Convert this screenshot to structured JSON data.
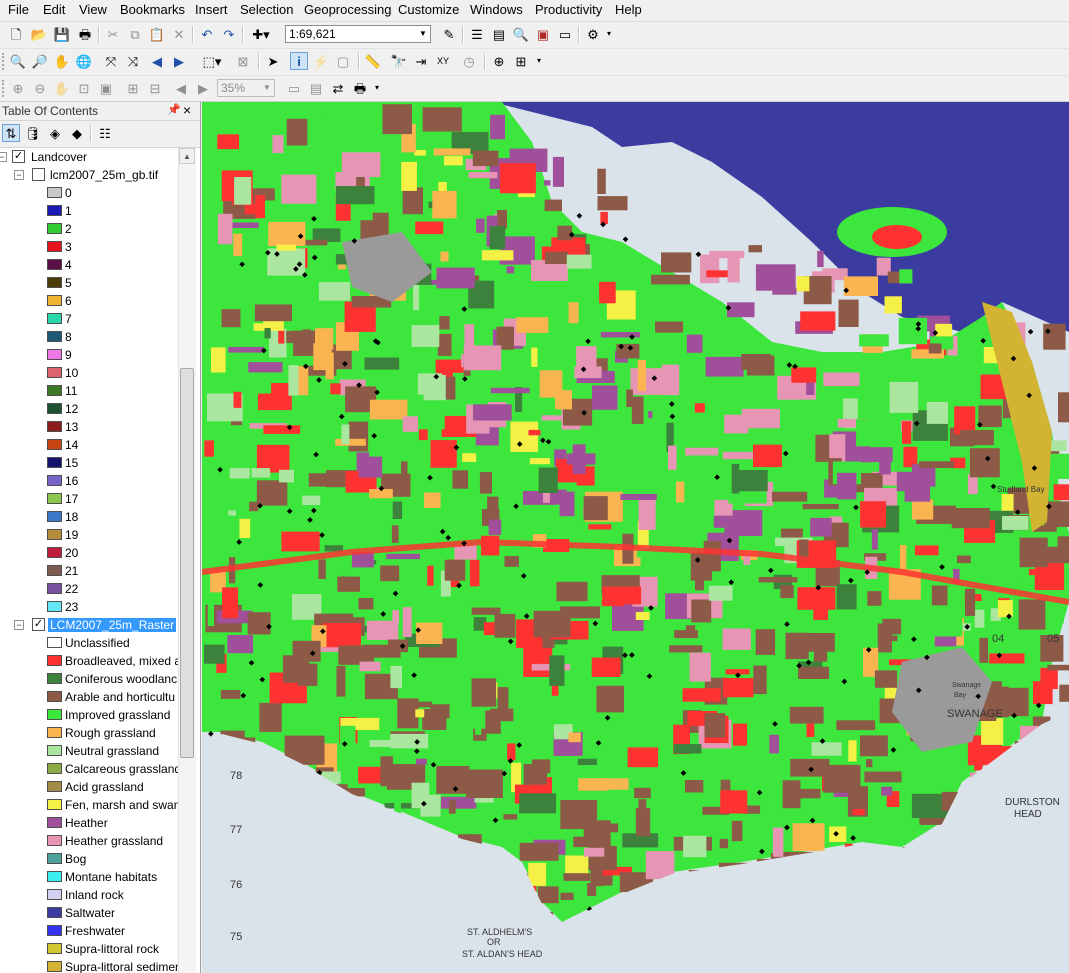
{
  "menu": [
    "File",
    "Edit",
    "View",
    "Bookmarks",
    "Insert",
    "Selection",
    "Geoprocessing",
    "Customize",
    "Windows",
    "Productivity",
    "Help"
  ],
  "toolbar": {
    "scale_value": "1:69,621",
    "zoom_percent": "35%"
  },
  "toc": {
    "title": "Table Of Contents",
    "pin_icon": "pin-icon",
    "close_icon": "close-icon",
    "group": {
      "name": "Landcover",
      "checked": true,
      "expanded": true
    },
    "layer1": {
      "name": "lcm2007_25m_gb.tif",
      "checked": false,
      "classes": [
        {
          "value": "0",
          "color": "#c8c8c8"
        },
        {
          "value": "1",
          "color": "#1b1bb4"
        },
        {
          "value": "2",
          "color": "#33cc33"
        },
        {
          "value": "3",
          "color": "#e6141e"
        },
        {
          "value": "4",
          "color": "#5a0f46"
        },
        {
          "value": "5",
          "color": "#4b3c0a"
        },
        {
          "value": "6",
          "color": "#f0b432"
        },
        {
          "value": "7",
          "color": "#28d7aa"
        },
        {
          "value": "8",
          "color": "#1e5a78"
        },
        {
          "value": "9",
          "color": "#f078e6"
        },
        {
          "value": "10",
          "color": "#dc646e"
        },
        {
          "value": "11",
          "color": "#3c7828"
        },
        {
          "value": "12",
          "color": "#1e5032"
        },
        {
          "value": "13",
          "color": "#8c1e1e"
        },
        {
          "value": "14",
          "color": "#c84614"
        },
        {
          "value": "15",
          "color": "#14146e"
        },
        {
          "value": "16",
          "color": "#7864c8"
        },
        {
          "value": "17",
          "color": "#8cc850"
        },
        {
          "value": "18",
          "color": "#3c78c8"
        },
        {
          "value": "19",
          "color": "#b48c3c"
        },
        {
          "value": "20",
          "color": "#be1e3c"
        },
        {
          "value": "21",
          "color": "#7d5a50"
        },
        {
          "value": "22",
          "color": "#7850a0"
        },
        {
          "value": "23",
          "color": "#64e6f5"
        }
      ]
    },
    "layer2": {
      "name": "LCM2007_25m_Raster",
      "checked": true,
      "selected": true,
      "classes": [
        {
          "label": "Unclassified",
          "color": "#ffffff"
        },
        {
          "label": "Broadleaved, mixed a",
          "color": "#ff3232"
        },
        {
          "label": "Coniferous woodlanc",
          "color": "#3c823c"
        },
        {
          "label": "Arable and horticultu",
          "color": "#8c5a46"
        },
        {
          "label": "Improved grassland",
          "color": "#3ce63c"
        },
        {
          "label": "Rough grassland",
          "color": "#fab450"
        },
        {
          "label": "Neutral grassland",
          "color": "#aae6a0"
        },
        {
          "label": "Calcareous grassland",
          "color": "#8caa46"
        },
        {
          "label": "Acid grassland",
          "color": "#a08c46"
        },
        {
          "label": "Fen, marsh and swam",
          "color": "#f5f046"
        },
        {
          "label": "Heather",
          "color": "#a0509b"
        },
        {
          "label": "Heather grassland",
          "color": "#e696b4"
        },
        {
          "label": "Bog",
          "color": "#50a09b"
        },
        {
          "label": "Montane habitats",
          "color": "#3cf0f0"
        },
        {
          "label": "Inland rock",
          "color": "#d2d2f0"
        },
        {
          "label": "Saltwater",
          "color": "#3c3ca0"
        },
        {
          "label": "Freshwater",
          "color": "#3232f0"
        },
        {
          "label": "Supra-littoral rock",
          "color": "#d2c832"
        },
        {
          "label": "Supra-littoral sedimen",
          "color": "#d2b432"
        }
      ]
    }
  },
  "map": {
    "place_labels": [
      "SWANAGE",
      "DURLSTON",
      "HEAD",
      "ST. ALDHELM'S",
      "OR",
      "ST. ALDAN'S HEAD",
      "Studland Bay",
      "Swanage",
      "Bay"
    ],
    "grid_labels": [
      "04",
      "05",
      "78",
      "77",
      "76",
      "75"
    ]
  }
}
